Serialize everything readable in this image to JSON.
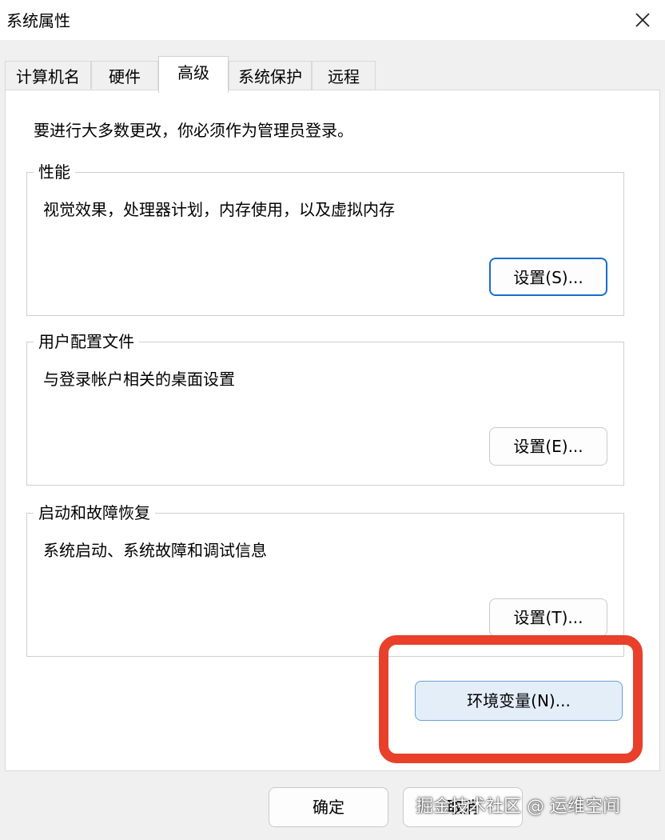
{
  "window": {
    "title": "系统属性",
    "close_icon": "close-icon"
  },
  "tabs": [
    {
      "label": "计算机名",
      "active": false
    },
    {
      "label": "硬件",
      "active": false
    },
    {
      "label": "高级",
      "active": true
    },
    {
      "label": "系统保护",
      "active": false
    },
    {
      "label": "远程",
      "active": false
    }
  ],
  "panel": {
    "intro": "要进行大多数更改，你必须作为管理员登录。",
    "groups": [
      {
        "legend": "性能",
        "description": "视觉效果，处理器计划，内存使用，以及虚拟内存",
        "button": "设置(S)..."
      },
      {
        "legend": "用户配置文件",
        "description": "与登录帐户相关的桌面设置",
        "button": "设置(E)..."
      },
      {
        "legend": "启动和故障恢复",
        "description": "系统启动、系统故障和调试信息",
        "button": "设置(T)..."
      }
    ],
    "env_button": "环境变量(N)..."
  },
  "footer": {
    "ok": "确定",
    "cancel": "取消"
  },
  "watermark": "掘金技术社区 @ 运维空间",
  "colors": {
    "highlight": "#e8402b",
    "accent": "#1a6cd0",
    "env_button_bg": "#e4eef9"
  }
}
